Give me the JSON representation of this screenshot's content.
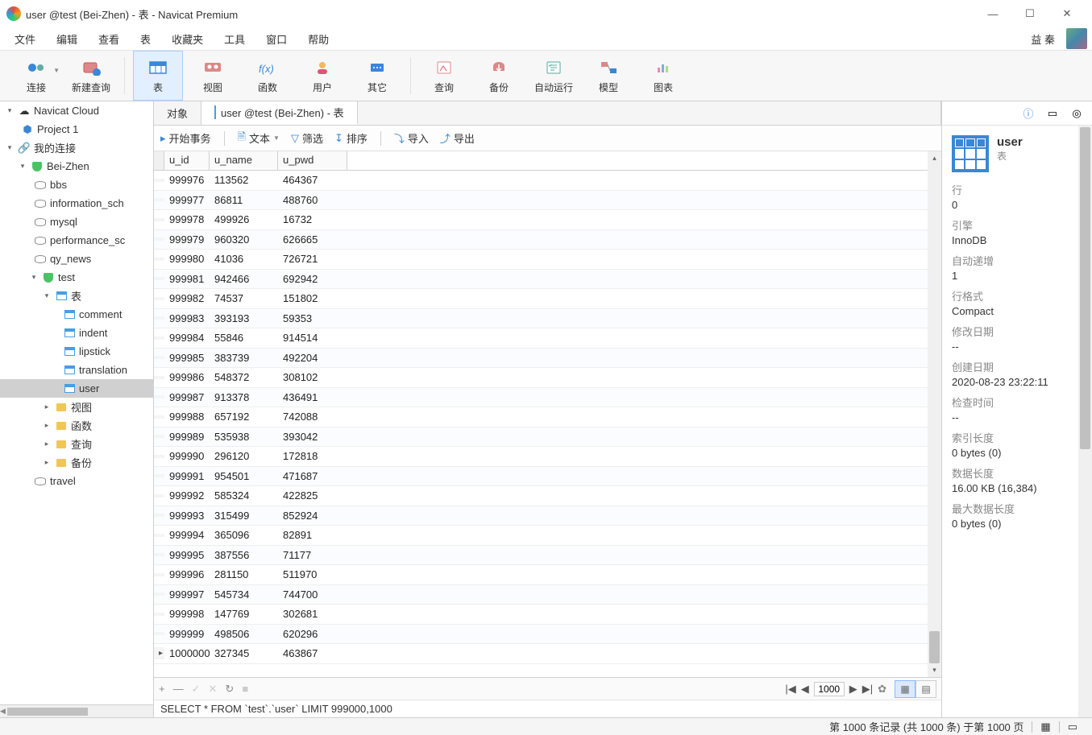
{
  "titlebar": {
    "title": "user @test (Bei-Zhen) - 表 - Navicat Premium"
  },
  "menu": {
    "items": [
      "文件",
      "编辑",
      "查看",
      "表",
      "收藏夹",
      "工具",
      "窗口",
      "帮助"
    ],
    "user": "益 秦"
  },
  "toolbar": {
    "connect": "连接",
    "newquery": "新建查询",
    "table": "表",
    "view": "视图",
    "function": "函数",
    "user": "用户",
    "other": "其它",
    "query": "查询",
    "backup": "备份",
    "autorun": "自动运行",
    "model": "模型",
    "chart": "图表"
  },
  "sidebar": {
    "cloud": "Navicat Cloud",
    "project": "Project 1",
    "myconn": "我的连接",
    "conns": [
      "Bei-Zhen"
    ],
    "dbs": [
      "bbs",
      "information_sch",
      "mysql",
      "performance_sc",
      "qy_news",
      "test",
      "travel"
    ],
    "test_tbl_label": "表",
    "tables": [
      "comment",
      "indent",
      "lipstick",
      "translation",
      "user"
    ],
    "categories": [
      "视图",
      "函数",
      "查询",
      "备份"
    ]
  },
  "tabs": {
    "objects": "对象",
    "active": "user @test (Bei-Zhen) - 表"
  },
  "subtoolbar": {
    "begin": "开始事务",
    "text": "文本",
    "filter": "筛选",
    "sort": "排序",
    "import": "导入",
    "export": "导出"
  },
  "grid": {
    "headers": [
      "u_id",
      "u_name",
      "u_pwd"
    ],
    "rows": [
      [
        "999976",
        "113562",
        "464367"
      ],
      [
        "999977",
        "86811",
        "488760"
      ],
      [
        "999978",
        "499926",
        "16732"
      ],
      [
        "999979",
        "960320",
        "626665"
      ],
      [
        "999980",
        "41036",
        "726721"
      ],
      [
        "999981",
        "942466",
        "692942"
      ],
      [
        "999982",
        "74537",
        "151802"
      ],
      [
        "999983",
        "393193",
        "59353"
      ],
      [
        "999984",
        "55846",
        "914514"
      ],
      [
        "999985",
        "383739",
        "492204"
      ],
      [
        "999986",
        "548372",
        "308102"
      ],
      [
        "999987",
        "913378",
        "436491"
      ],
      [
        "999988",
        "657192",
        "742088"
      ],
      [
        "999989",
        "535938",
        "393042"
      ],
      [
        "999990",
        "296120",
        "172818"
      ],
      [
        "999991",
        "954501",
        "471687"
      ],
      [
        "999992",
        "585324",
        "422825"
      ],
      [
        "999993",
        "315499",
        "852924"
      ],
      [
        "999994",
        "365096",
        "82891"
      ],
      [
        "999995",
        "387556",
        "71177"
      ],
      [
        "999996",
        "281150",
        "511970"
      ],
      [
        "999997",
        "545734",
        "744700"
      ],
      [
        "999998",
        "147769",
        "302681"
      ],
      [
        "999999",
        "498506",
        "620296"
      ],
      [
        "1000000",
        "327345",
        "463867"
      ]
    ]
  },
  "gridfoot": {
    "page": "1000"
  },
  "sqlbar": {
    "text": "SELECT * FROM `test`.`user` LIMIT 999000,1000"
  },
  "rightpanel": {
    "title": "user",
    "subtitle": "表",
    "fields": [
      {
        "lbl": "行",
        "val": "0"
      },
      {
        "lbl": "引擎",
        "val": "InnoDB"
      },
      {
        "lbl": "自动递增",
        "val": "1"
      },
      {
        "lbl": "行格式",
        "val": "Compact"
      },
      {
        "lbl": "修改日期",
        "val": "--"
      },
      {
        "lbl": "创建日期",
        "val": "2020-08-23 23:22:11"
      },
      {
        "lbl": "检查时间",
        "val": "--"
      },
      {
        "lbl": "索引长度",
        "val": "0 bytes (0)"
      },
      {
        "lbl": "数据长度",
        "val": "16.00 KB (16,384)"
      },
      {
        "lbl": "最大数据长度",
        "val": "0 bytes (0)"
      }
    ]
  },
  "statusbar": {
    "records": "第 1000 条记录 (共 1000 条) 于第 1000 页"
  }
}
